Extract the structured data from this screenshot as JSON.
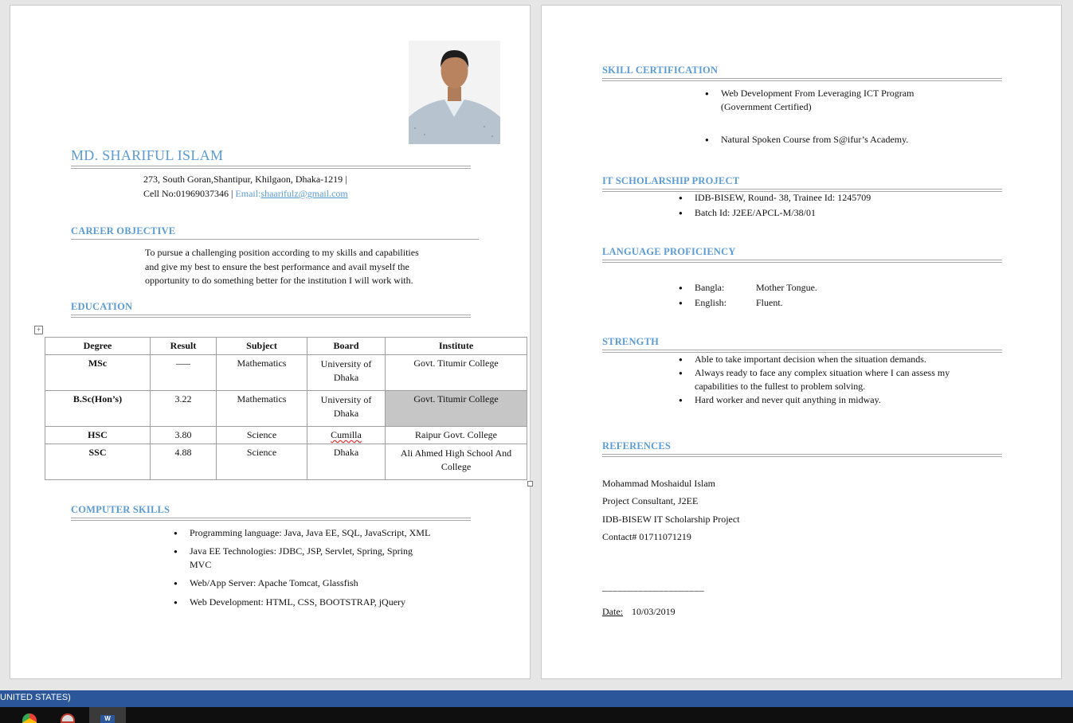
{
  "resume": {
    "name": "MD. SHARIFUL ISLAM",
    "address": "273, South Goran,Shantipur, Khilgaon, Dhaka-1219 |",
    "cell": "Cell No:01969037346 |",
    "email_label": "Email:",
    "email_value": "shaarifulz@gmail.com",
    "career_heading": "CAREER OBJECTIVE",
    "career_lines": [
      "To pursue a challenging position according to my skills and capabilities",
      "and give my best to ensure the best performance and avail myself the",
      "opportunity to do something better for the institution I will work with."
    ],
    "education_heading": "EDUCATION",
    "education": {
      "headers": [
        "Degree",
        "Result",
        "Subject",
        "Board",
        "Institute"
      ],
      "rows": [
        {
          "degree": "MSc",
          "result": "–––",
          "subject": "Mathematics",
          "board": "University of Dhaka",
          "institute": "Govt. Titumir College"
        },
        {
          "degree": "B.Sc(Hon’s)",
          "result": "3.22",
          "subject": "Mathematics",
          "board": "University of Dhaka",
          "institute": "Govt. Titumir College"
        },
        {
          "degree": "HSC",
          "result": "3.80",
          "subject": "Science",
          "board": "Cumilla",
          "institute": "Raipur Govt. College"
        },
        {
          "degree": "SSC",
          "result": "4.88",
          "subject": "Science",
          "board": "Dhaka",
          "institute": "Ali Ahmed High School And College"
        }
      ]
    },
    "computer_heading": "COMPUTER SKILLS",
    "computer_skills": [
      "Programming language: Java, Java EE, SQL, JavaScript, XML",
      "Java EE Technologies: JDBC, JSP, Servlet, Spring, Spring MVC",
      "Web/App Server: Apache Tomcat, Glassfish",
      "Web Development: HTML, CSS, BOOTSTRAP, jQuery"
    ],
    "skill_cert_heading": "SKILL CERTIFICATION",
    "skill_certs": [
      "Web Development From Leveraging ICT  Program (Government Certified)",
      "Natural Spoken Course from S@ifur’s Academy."
    ],
    "it_heading": "IT SCHOLARSHIP PROJECT",
    "it_items": [
      "IDB-BISEW, Round- 38, Trainee Id: 1245709",
      "Batch Id: J2EE/APCL-M/38/01"
    ],
    "lang_heading": "LANGUAGE PROFICIENCY",
    "languages": [
      {
        "name": "Bangla:",
        "level": "Mother Tongue."
      },
      {
        "name": "English:",
        "level": "Fluent."
      }
    ],
    "strength_heading": "STRENGTH",
    "strengths": [
      "Able to take important decision when the situation demands.",
      "Always ready to face any complex situation where I can assess my capabilities to the fullest to problem solving.",
      "Hard worker and never quit anything in midway."
    ],
    "references_heading": "REFERENCES",
    "references": [
      "Mohammad Moshaidul Islam",
      "Project Consultant, J2EE",
      "IDB-BISEW IT Scholarship Project",
      "Contact# 01711071219"
    ],
    "signature_line": "____________________",
    "date_label": "Date:",
    "date_value": "10/03/2019"
  },
  "statusbar": {
    "language_text": "UNITED STATES)"
  },
  "colors": {
    "accent": "#5b9bd5",
    "statusbar": "#2b579a",
    "taskbar": "#0f0f0f"
  }
}
